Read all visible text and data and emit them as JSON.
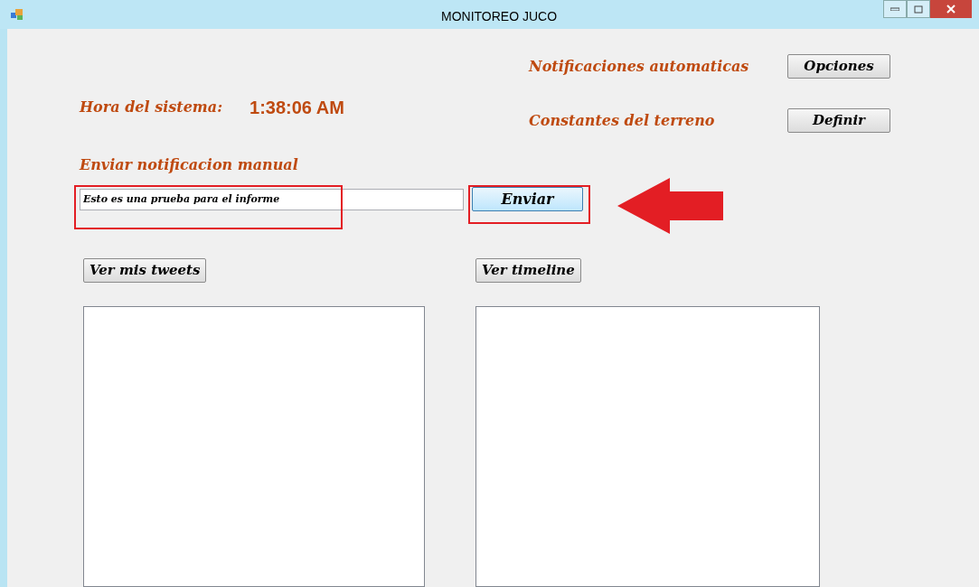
{
  "window": {
    "title": "MONITOREO JUCO"
  },
  "clock": {
    "label": "Hora del sistema:",
    "time": "1:38:06 AM"
  },
  "settings": [
    {
      "label": "Notificaciones automaticas",
      "button": "Opciones"
    },
    {
      "label": "Constantes del terreno",
      "button": "Definir"
    }
  ],
  "manual": {
    "label": "Enviar notificacion manual",
    "value": "Esto es una prueba para el informe",
    "button": "Enviar"
  },
  "lists": [
    {
      "button": "Ver mis tweets"
    },
    {
      "button": "Ver timeline"
    }
  ]
}
